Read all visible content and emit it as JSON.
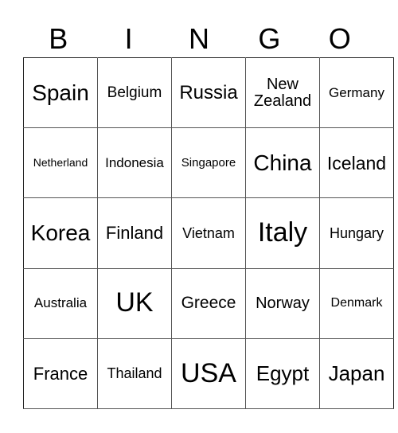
{
  "header": [
    "B",
    "I",
    "N",
    "G",
    "O"
  ],
  "cells": [
    [
      {
        "text": "Spain",
        "size": 28
      },
      {
        "text": "Belgium",
        "size": 19
      },
      {
        "text": "Russia",
        "size": 24
      },
      {
        "text": "New Zealand",
        "size": 20
      },
      {
        "text": "Germany",
        "size": 17
      }
    ],
    [
      {
        "text": "Netherland",
        "size": 14
      },
      {
        "text": "Indonesia",
        "size": 17
      },
      {
        "text": "Singapore",
        "size": 15
      },
      {
        "text": "China",
        "size": 28
      },
      {
        "text": "Iceland",
        "size": 23
      }
    ],
    [
      {
        "text": "Korea",
        "size": 28
      },
      {
        "text": "Finland",
        "size": 22
      },
      {
        "text": "Vietnam",
        "size": 18
      },
      {
        "text": "Italy",
        "size": 34
      },
      {
        "text": "Hungary",
        "size": 18
      }
    ],
    [
      {
        "text": "Australia",
        "size": 17
      },
      {
        "text": "UK",
        "size": 34
      },
      {
        "text": "Greece",
        "size": 21
      },
      {
        "text": "Norway",
        "size": 20
      },
      {
        "text": "Denmark",
        "size": 16
      }
    ],
    [
      {
        "text": "France",
        "size": 22
      },
      {
        "text": "Thailand",
        "size": 18
      },
      {
        "text": "USA",
        "size": 34
      },
      {
        "text": "Egypt",
        "size": 26
      },
      {
        "text": "Japan",
        "size": 26
      }
    ]
  ]
}
